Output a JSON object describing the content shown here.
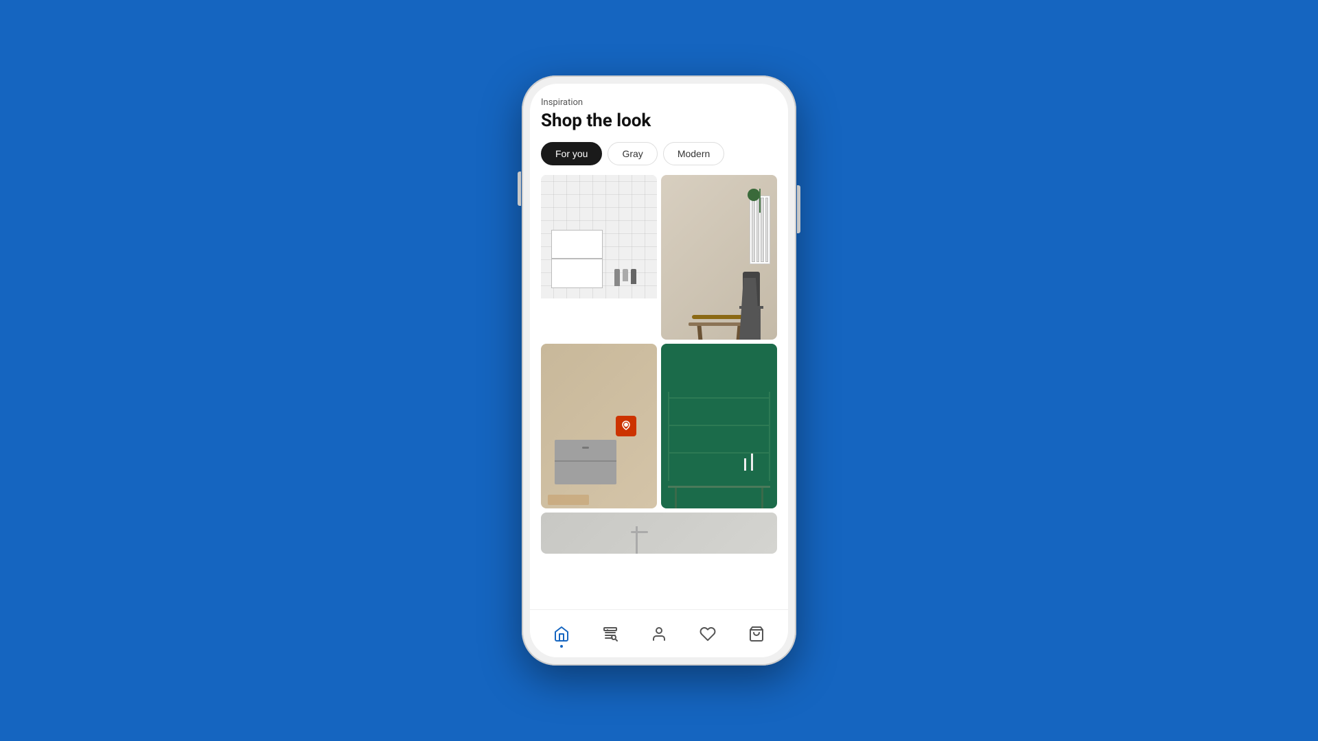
{
  "background_color": "#1565C0",
  "page": {
    "inspiration_label": "Inspiration",
    "title": "Shop the look",
    "filters": [
      {
        "id": "for-you",
        "label": "For you",
        "active": true
      },
      {
        "id": "gray",
        "label": "Gray",
        "active": false
      },
      {
        "id": "modern",
        "label": "Modern",
        "active": false
      }
    ],
    "grid_items": [
      {
        "id": "kitchen",
        "alt": "Kitchen shelf with white tiles and bottles",
        "type": "kitchen"
      },
      {
        "id": "dining",
        "alt": "Dining table with chair and radiator",
        "type": "dining"
      },
      {
        "id": "living",
        "alt": "Living room dresser with cozy decor",
        "type": "living"
      },
      {
        "id": "green-room",
        "alt": "Green wall office/study with shelving",
        "type": "green"
      },
      {
        "id": "bottom",
        "alt": "Bathroom or kitchen detail",
        "type": "bottom"
      }
    ]
  },
  "nav": {
    "items": [
      {
        "id": "home",
        "label": "Home",
        "active": true
      },
      {
        "id": "search",
        "label": "Search",
        "active": false
      },
      {
        "id": "profile",
        "label": "Profile",
        "active": false
      },
      {
        "id": "wishlist",
        "label": "Wishlist",
        "active": false
      },
      {
        "id": "cart",
        "label": "Cart",
        "active": false
      }
    ]
  }
}
